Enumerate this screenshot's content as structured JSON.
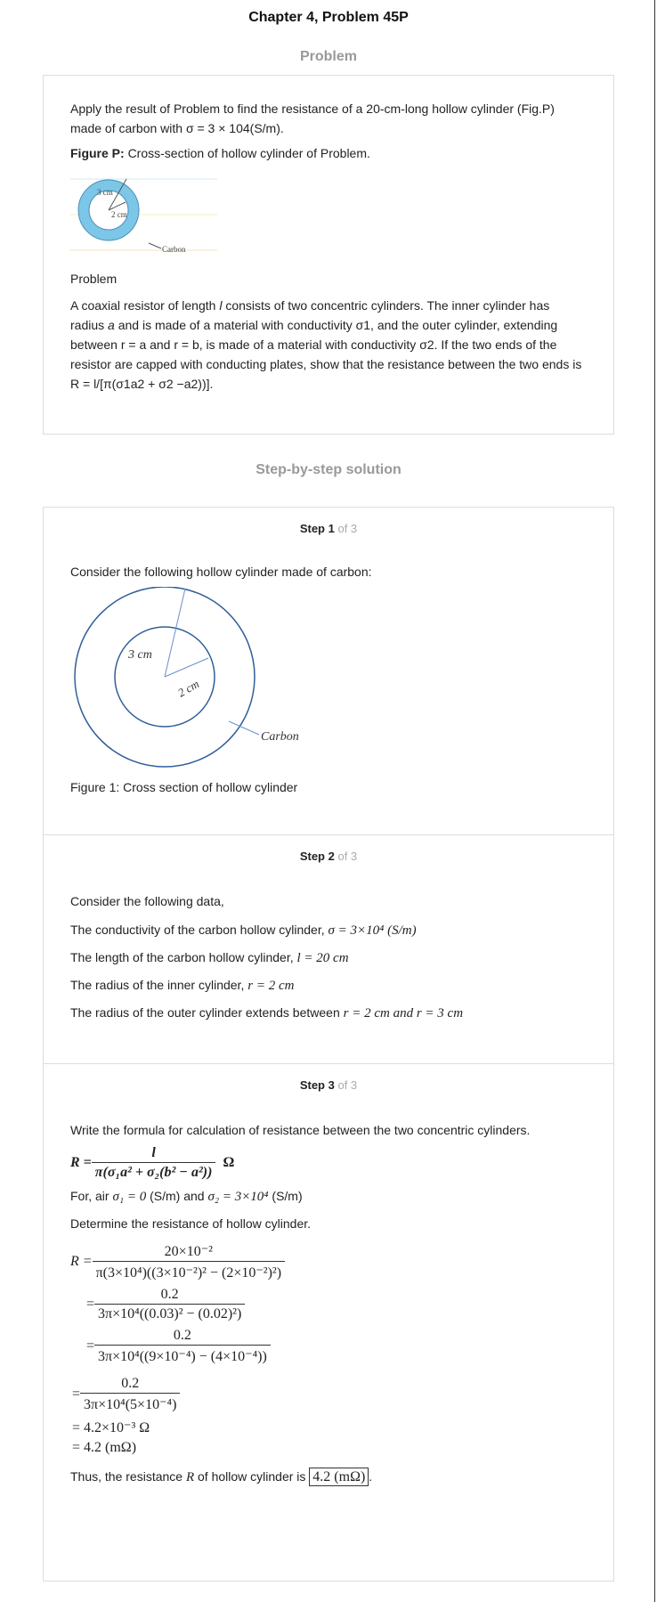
{
  "title": "Chapter 4, Problem 45P",
  "problem_heading": "Problem",
  "problem": {
    "intro_1": "Apply the result of Problem to find the resistance of a 20-cm-long hollow cylinder (Fig.P)",
    "intro_2": "made of carbon with σ = 3 × 104(S/m).",
    "figure_label": "Figure P:",
    "figure_caption": "Cross-section of hollow cylinder of Problem.",
    "figure_labels": {
      "outer": "3 cm",
      "inner": "2 cm",
      "material": "Carbon"
    },
    "sub_heading": "Problem",
    "text_1": "A coaxial resistor of length ",
    "text_l": "l",
    "text_2": " consists of two concentric cylinders. The inner cylinder has radius ",
    "text_a": "a",
    "text_3": " and is made of a material with conductivity σ1, and the outer cylinder, extending between r = a and r = b, is made of a material with conductivity σ2. If the two ends of the resistor are capped with conducting plates, show that the resistance between the two ends is R = l/[π(σ1a2 + σ2 −a2))]."
  },
  "solution_heading": "Step-by-step solution",
  "steps": [
    {
      "label": "Step 1",
      "of": "of 3",
      "text": "Consider the following hollow cylinder made of carbon:",
      "fig": {
        "outer": "3 cm",
        "inner": "2 cm",
        "material": "Carbon"
      },
      "caption": "Figure 1: Cross section of hollow cylinder"
    },
    {
      "label": "Step 2",
      "of": "of 3",
      "intro": "Consider the following data,",
      "lines": [
        {
          "text": "The conductivity of the carbon hollow cylinder,",
          "math": "σ = 3×10⁴ (S/m)"
        },
        {
          "text": "The length of the carbon hollow cylinder,",
          "math": "l = 20 cm"
        },
        {
          "text": "The radius of the inner cylinder,",
          "math": "r = 2 cm"
        },
        {
          "text": "The radius of the outer cylinder extends between",
          "math": "r = 2 cm  and r = 3 cm"
        }
      ]
    },
    {
      "label": "Step 3",
      "of": "of 3",
      "intro": "Write the formula for calculation of resistance between the two concentric cylinders.",
      "formula": {
        "lhs": "R =",
        "num": "l",
        "den": "π(σ₁a² + σ₂(b² − a²))",
        "unit": "Ω"
      },
      "for_air_text": "For, air",
      "sigma1": "σ₁ = 0",
      "sigma1_unit": "(S/m) and",
      "sigma2": "σ₂ = 3×10⁴",
      "sigma2_unit": "(S/m)",
      "determine": "Determine the resistance of hollow cylinder.",
      "calc": [
        {
          "lhs": "R =",
          "num": "20×10⁻²",
          "den": "π(3×10⁴)((3×10⁻²)² − (2×10⁻²)²)"
        },
        {
          "lhs": "=",
          "num": "0.2",
          "den": "3π×10⁴((0.03)² − (0.02)²)"
        },
        {
          "lhs": "=",
          "num": "0.2",
          "den": "3π×10⁴((9×10⁻⁴) − (4×10⁻⁴))"
        },
        {
          "lhs": "=",
          "num": "0.2",
          "den": "3π×10⁴(5×10⁻⁴)"
        }
      ],
      "result_1": "= 4.2×10⁻³ Ω",
      "result_2": "= 4.2 (mΩ)",
      "conclusion_pre": "Thus, the resistance",
      "conclusion_var": "R",
      "conclusion_mid": "of hollow cylinder is",
      "answer": "4.2 (mΩ)",
      "conclusion_end": "."
    }
  ]
}
